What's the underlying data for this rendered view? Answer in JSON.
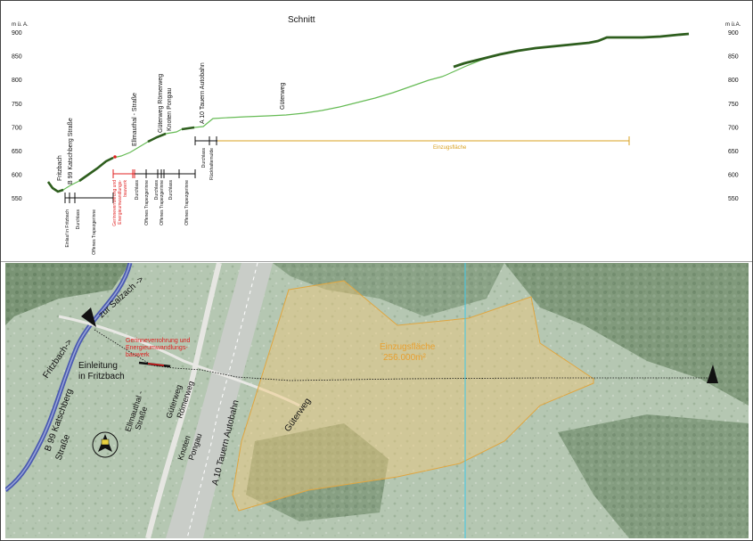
{
  "profile": {
    "title": "Schnitt",
    "axis_unit_left": "m ü. A.",
    "axis_unit_right": "m ü.A.",
    "ticks": [
      "900",
      "850",
      "800",
      "750",
      "700",
      "650",
      "600",
      "550"
    ],
    "colors": {
      "line_light": "#66bb55",
      "line_dark": "#2e5e1e",
      "scale": "#111111",
      "red": "#e02020",
      "orange": "#d9a020"
    },
    "upper_labels": [
      {
        "text": "Fritzbach"
      },
      {
        "text": "B 99 Katschberg Straße"
      },
      {
        "text": "Ellmauthal - Straße"
      },
      {
        "text": "Güterweg Römerweg"
      },
      {
        "text": "Knoten Pongau"
      },
      {
        "text": "A 10 Tauern Autobahn"
      },
      {
        "text": "Güterweg"
      }
    ],
    "einzugsflaeche_label": "Einzugsfläche",
    "lower_labels": [
      {
        "text": "Einlauf in Fritzbach",
        "color": "#111111"
      },
      {
        "text": "Durchlass",
        "color": "#111111"
      },
      {
        "text": "Offenes Trapezgerinne",
        "color": "#111111"
      },
      {
        "text": "Gerinneverrohrung und",
        "color": "#e02020"
      },
      {
        "text": "Energieumwandlungs-",
        "color": "#e02020"
      },
      {
        "text": "bauwerk",
        "color": "#e02020"
      },
      {
        "text": "Durchlass",
        "color": "#111111"
      },
      {
        "text": "Offenes Trapezgerinne",
        "color": "#111111"
      },
      {
        "text": "Durchlass",
        "color": "#111111"
      },
      {
        "text": "Offenes Trapezgerinne",
        "color": "#111111"
      },
      {
        "text": "Durchlass",
        "color": "#111111"
      },
      {
        "text": "Offenes Trapezgerinne",
        "color": "#111111"
      },
      {
        "text": "Durchlass",
        "color": "#111111"
      },
      {
        "text": "Rückhaltemulde",
        "color": "#111111"
      }
    ]
  },
  "map": {
    "colors": {
      "catchment_fill": "#f2c878",
      "catchment_stroke": "#e0a640",
      "river": "#4a5ab0",
      "cyan_line": "#40c8e8",
      "red_label": "#e02020",
      "orange_label": "#e8a030"
    },
    "labels": {
      "zur_salzach": "zur Salzach ->",
      "fritzbach": "Fritzbach->",
      "einleitung_1": "Einleitung",
      "einleitung_2": "in Fritzbach",
      "gerinne_1": "Gerinneverrohrung und",
      "gerinne_2": "Energieumwandlungs-",
      "gerinne_3": "bauwerk",
      "b99_1": "B 99 Katschberg",
      "b99_2": "Straße",
      "ellmauthal_1": "Ellmauthal -",
      "ellmauthal_2": "Straße",
      "gueterweg_roemerweg_1": "Güterweg",
      "gueterweg_roemerweg_2": "Römerweg",
      "knoten_1": "Knoten",
      "knoten_2": "Pongau",
      "autobahn": "A 10 Tauern Autobahn",
      "gueterweg": "Güterweg",
      "einzugsflaeche_1": "Einzugsfläche",
      "einzugsflaeche_2": "256.000m²"
    }
  }
}
